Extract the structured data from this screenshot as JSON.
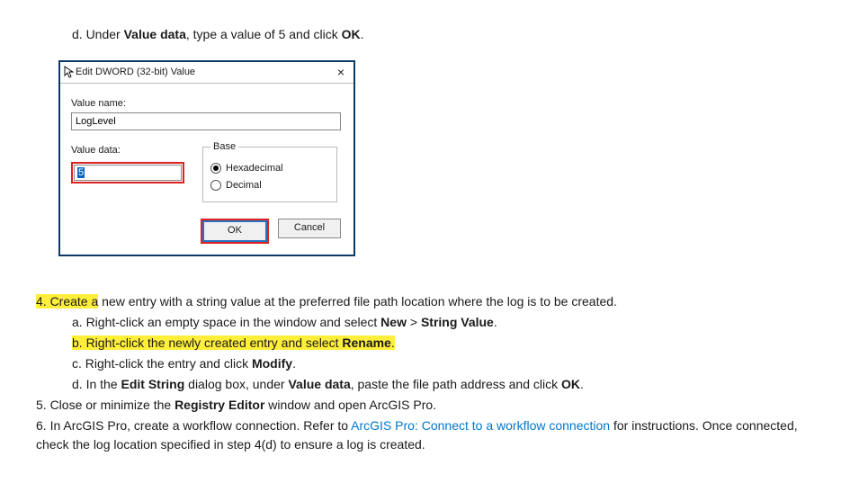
{
  "intro_step_d": {
    "prefix": "d. Under ",
    "bold1": "Value data",
    "mid": ", type a value of 5 and click ",
    "bold2": "OK",
    "suffix": "."
  },
  "dialog": {
    "title": "Edit DWORD (32-bit) Value",
    "close": "×",
    "value_name_label": "Value name:",
    "value_name": "LogLevel",
    "value_data_label": "Value data:",
    "value_data": "5",
    "base_legend": "Base",
    "hex_label": "Hexadecimal",
    "dec_label": "Decimal",
    "ok": "OK",
    "cancel": "Cancel"
  },
  "steps": {
    "s4": {
      "hl": "4. Create a",
      "rest": " new entry with a string value at the preferred file path location where the log is to be created."
    },
    "s4a": {
      "prefix": "a. Right-click an empty space in the window and select ",
      "bold1": "New",
      "mid": " > ",
      "bold2": "String Value",
      "suffix": "."
    },
    "s4b": {
      "hl_prefix": "b. Right-click the newly created entry and select ",
      "hl_bold": "Rename",
      "hl_suffix": "."
    },
    "s4c": {
      "prefix": "c. Right-click the entry and click ",
      "bold": "Modify",
      "suffix": "."
    },
    "s4d": {
      "prefix": "d. In the ",
      "bold1": "Edit String",
      "mid1": " dialog box, under ",
      "bold2": "Value data",
      "mid2": ", paste the file path address and click ",
      "bold3": "OK",
      "suffix": "."
    },
    "s5": {
      "prefix": "5. Close or minimize the ",
      "bold": "Registry Editor",
      "suffix": " window and open ArcGIS Pro."
    },
    "s6": {
      "prefix": "6. In ArcGIS Pro, create a workflow connection. Refer to ",
      "link": "ArcGIS Pro: Connect to a workflow connection",
      "mid": " for instructions. Once connected, check the log location specified in step 4(d) to ensure a log is created."
    }
  }
}
